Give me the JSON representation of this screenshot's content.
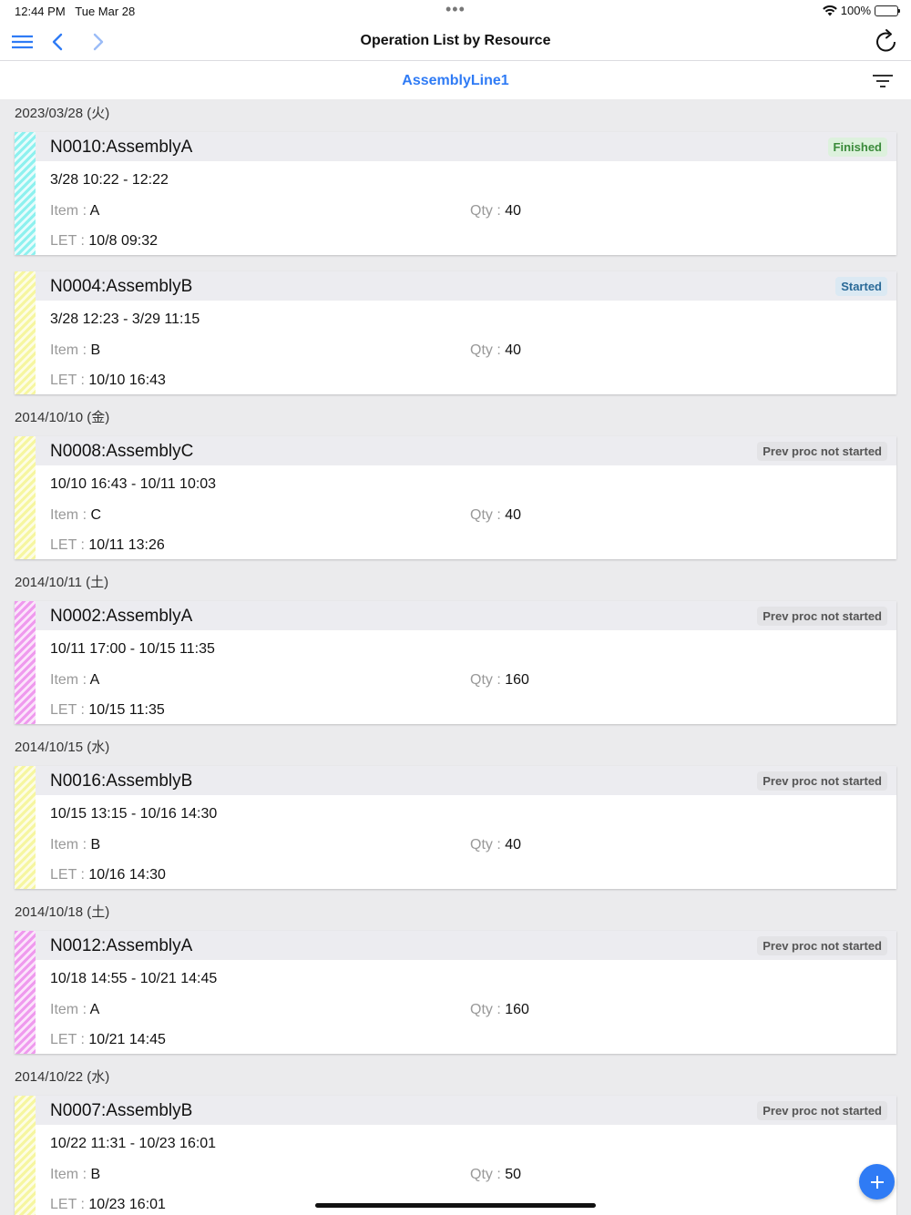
{
  "status_bar": {
    "time": "12:44 PM",
    "date": "Tue Mar 28",
    "battery": "100%"
  },
  "nav": {
    "title": "Operation List by Resource"
  },
  "resource": {
    "name": "AssemblyLine1"
  },
  "groups": [
    {
      "date": "2023/03/28 (火)",
      "cards": [
        {
          "title": "N0010:AssemblyA",
          "status": "Finished",
          "time": "3/28 10:22 - 12:22",
          "item_label": "Item",
          "item": "A",
          "qty_label": "Qty",
          "qty": "40",
          "let_label": "LET",
          "let": "10/8 09:32"
        },
        {
          "title": "N0004:AssemblyB",
          "status": "Started",
          "time": "3/28 12:23 - 3/29 11:15",
          "item_label": "Item",
          "item": "B",
          "qty_label": "Qty",
          "qty": "40",
          "let_label": "LET",
          "let": "10/10 16:43"
        }
      ]
    },
    {
      "date": "2014/10/10 (金)",
      "cards": [
        {
          "title": "N0008:AssemblyC",
          "status": "Prev proc not started",
          "time": "10/10 16:43 - 10/11 10:03",
          "item_label": "Item",
          "item": "C",
          "qty_label": "Qty",
          "qty": "40",
          "let_label": "LET",
          "let": "10/11 13:26"
        }
      ]
    },
    {
      "date": "2014/10/11 (土)",
      "cards": [
        {
          "title": "N0002:AssemblyA",
          "status": "Prev proc not started",
          "time": "10/11 17:00 - 10/15 11:35",
          "item_label": "Item",
          "item": "A",
          "qty_label": "Qty",
          "qty": "160",
          "let_label": "LET",
          "let": "10/15 11:35"
        }
      ]
    },
    {
      "date": "2014/10/15 (水)",
      "cards": [
        {
          "title": "N0016:AssemblyB",
          "status": "Prev proc not started",
          "time": "10/15 13:15 - 10/16 14:30",
          "item_label": "Item",
          "item": "B",
          "qty_label": "Qty",
          "qty": "40",
          "let_label": "LET",
          "let": "10/16 14:30"
        }
      ]
    },
    {
      "date": "2014/10/18 (土)",
      "cards": [
        {
          "title": "N0012:AssemblyA",
          "status": "Prev proc not started",
          "time": "10/18 14:55 - 10/21 14:45",
          "item_label": "Item",
          "item": "A",
          "qty_label": "Qty",
          "qty": "160",
          "let_label": "LET",
          "let": "10/21 14:45"
        }
      ]
    },
    {
      "date": "2014/10/22 (水)",
      "cards": [
        {
          "title": "N0007:AssemblyB",
          "status": "Prev proc not started",
          "time": "10/22 11:31 - 10/23 16:01",
          "item_label": "Item",
          "item": "B",
          "qty_label": "Qty",
          "qty": "50",
          "let_label": "LET",
          "let": "10/23 16:01"
        }
      ]
    }
  ],
  "colors": {
    "accent": "#2f7bf5",
    "finished_badge": "#ddf1dd",
    "started_badge": "#dbe9f3",
    "pending_badge": "#e3e3e6",
    "stripe_cyan": "#8ef1ef",
    "stripe_yellow": "#f6f6a0",
    "stripe_magenta": "#ef9aee"
  }
}
